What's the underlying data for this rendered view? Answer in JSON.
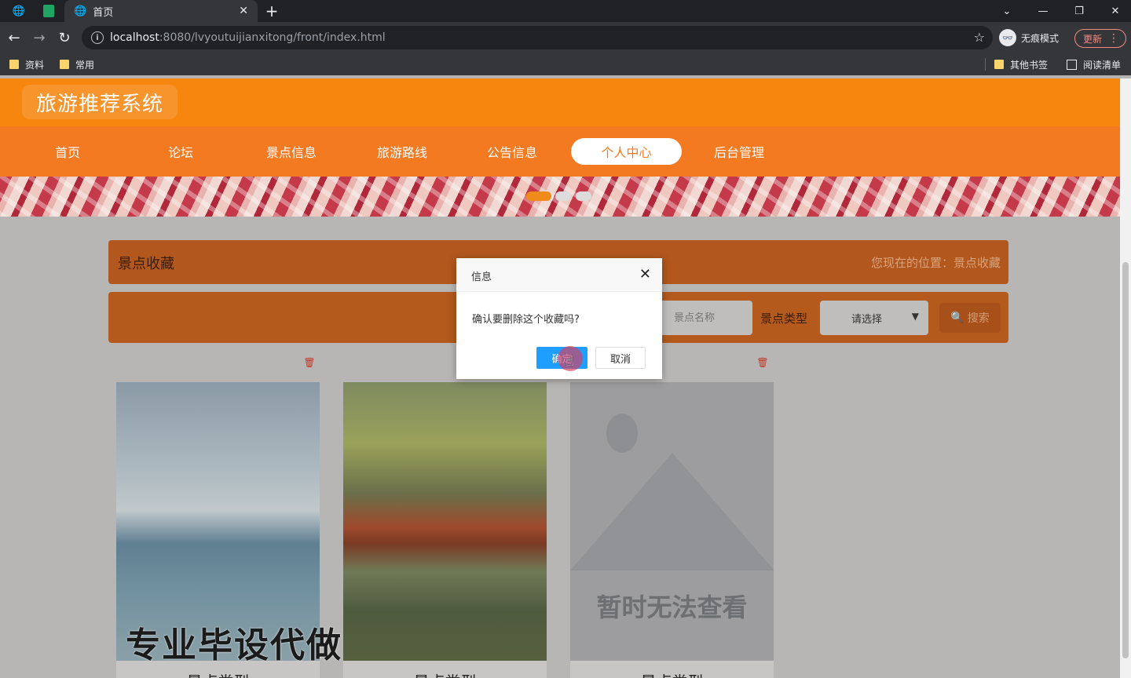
{
  "browser": {
    "tab_title": "首页",
    "tab_close": "✕",
    "new_tab": "+",
    "url_host": "localhost",
    "url_rest": ":8080/lvyoutuijianxitong/front/index.html",
    "profile_label": "无痕模式",
    "update_label": "更新",
    "bookmarks": [
      "资料",
      "常用"
    ],
    "other_bookmarks": "其他书签",
    "reading_list": "阅读清单"
  },
  "site": {
    "title": "旅游推荐系统",
    "nav": [
      "首页",
      "论坛",
      "景点信息",
      "旅游路线",
      "公告信息",
      "个人中心",
      "后台管理"
    ],
    "active_nav": "个人中心"
  },
  "breadcrumb": {
    "title": "景点收藏",
    "position": "您现在的位置：景点收藏"
  },
  "search": {
    "name_placeholder": "景点名称",
    "type_label": "景点类型",
    "type_select": "请选择",
    "button_label": "搜索"
  },
  "cards": [
    {
      "name": "景点类型",
      "image": "lake-willow"
    },
    {
      "name": "景点类型",
      "image": "summer-palace"
    },
    {
      "name": "景点类型",
      "image": "placeholder",
      "placeholder_text": "暂时无法查看"
    }
  ],
  "watermark": "专业毕设代做",
  "dialog": {
    "title": "信息",
    "message": "确认要删除这个收藏吗?",
    "ok_label": "确定",
    "cancel_label": "取消"
  },
  "colors": {
    "header": "#f7860f",
    "nav": "#f47a22",
    "dialog_ok": "#1e9fff"
  }
}
